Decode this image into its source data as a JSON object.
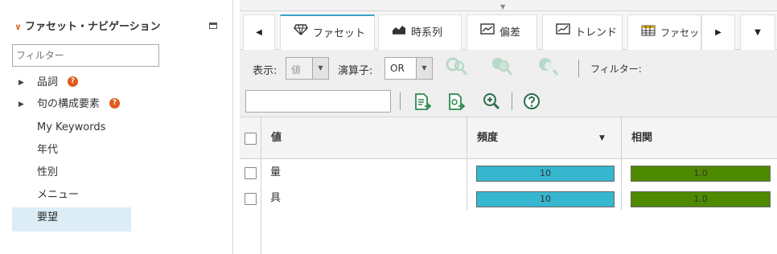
{
  "left_panel": {
    "title": "ファセット・ナビゲーション",
    "filter_placeholder": "フィルター",
    "items": [
      {
        "label": "品詞",
        "expandable": true,
        "help": true
      },
      {
        "label": "句の構成要素",
        "expandable": true,
        "help": true
      },
      {
        "label": "My Keywords",
        "expandable": false,
        "help": false
      },
      {
        "label": "年代",
        "expandable": false,
        "help": false
      },
      {
        "label": "性別",
        "expandable": false,
        "help": false
      },
      {
        "label": "メニュー",
        "expandable": false,
        "help": false
      },
      {
        "label": "要望",
        "expandable": false,
        "help": false,
        "selected": true
      }
    ]
  },
  "tabs": {
    "items": [
      {
        "label": "ファセット",
        "icon": "diamond-icon",
        "active": true
      },
      {
        "label": "時系列",
        "icon": "area-chart-icon"
      },
      {
        "label": "偏差",
        "icon": "deviation-chart-icon"
      },
      {
        "label": "トレンド",
        "icon": "trend-chart-icon"
      },
      {
        "label": "ファセット",
        "icon": "table-icon"
      }
    ]
  },
  "toolbar": {
    "display_label": "表示:",
    "display_value": "値",
    "operator_label": "演算子:",
    "operator_value": "OR",
    "filter_label": "フィルター:",
    "search_value": ""
  },
  "grid": {
    "columns": [
      "値",
      "頻度",
      "相関"
    ],
    "sort_column": "頻度",
    "rows": [
      {
        "value": "量",
        "frequency": "10",
        "correlation": "1.0"
      },
      {
        "value": "具",
        "frequency": "10",
        "correlation": "1.0"
      }
    ]
  },
  "colors": {
    "frequency_bar": "#37b6cf",
    "correlation_bar": "#4e8a00",
    "selected_item": "#dcedf7",
    "accent": "#e06b2d",
    "help_badge": "#e25a1c",
    "active_tab": "#3aa3c9"
  }
}
